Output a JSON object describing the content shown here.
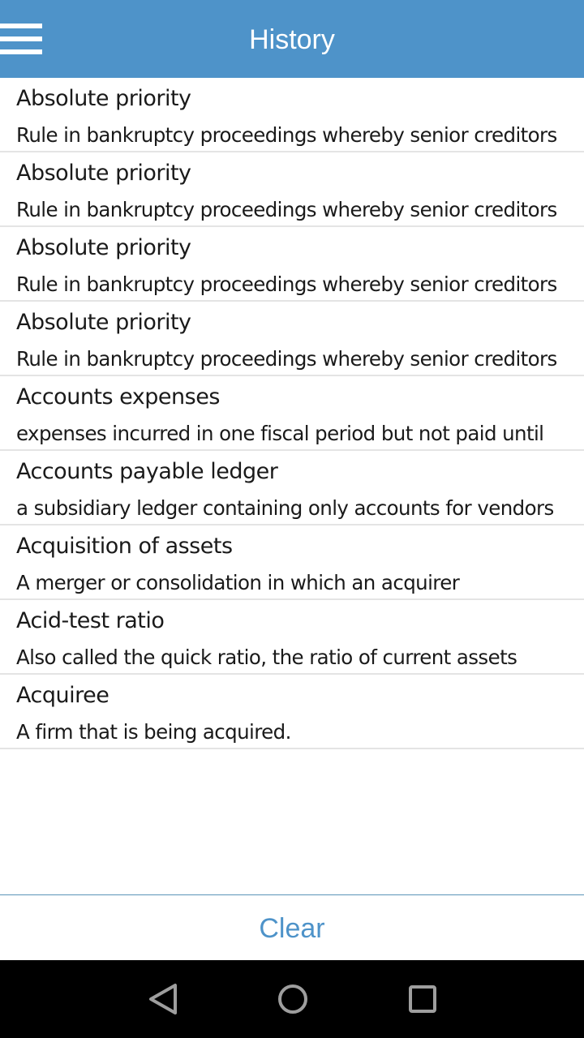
{
  "header": {
    "title": "History",
    "menu_icon": "hamburger-menu-icon"
  },
  "history": [
    {
      "term": "Absolute priority",
      "definition": "Rule in bankruptcy proceedings whereby senior creditors"
    },
    {
      "term": "Absolute priority",
      "definition": "Rule in bankruptcy proceedings whereby senior creditors"
    },
    {
      "term": "Absolute priority",
      "definition": "Rule in bankruptcy proceedings whereby senior creditors"
    },
    {
      "term": "Absolute priority",
      "definition": "Rule in bankruptcy proceedings whereby senior creditors"
    },
    {
      "term": "Accounts expenses",
      "definition": "expenses incurred in one fiscal period but not paid until"
    },
    {
      "term": "Accounts payable ledger",
      "definition": "a subsidiary ledger containing only accounts for vendors"
    },
    {
      "term": "Acquisition of assets",
      "definition": "A merger or consolidation in which an acquirer"
    },
    {
      "term": "Acid-test ratio",
      "definition": "Also called the quick ratio, the ratio of current assets"
    },
    {
      "term": "Acquiree",
      "definition": "A firm that is being acquired."
    }
  ],
  "footer": {
    "clear_label": "Clear"
  },
  "navbar": {
    "back_icon": "back-triangle-icon",
    "home_icon": "home-circle-icon",
    "recents_icon": "recents-square-icon"
  },
  "colors": {
    "accent": "#4e93c9",
    "navbar": "#000000",
    "separator": "#e4e4e4"
  }
}
